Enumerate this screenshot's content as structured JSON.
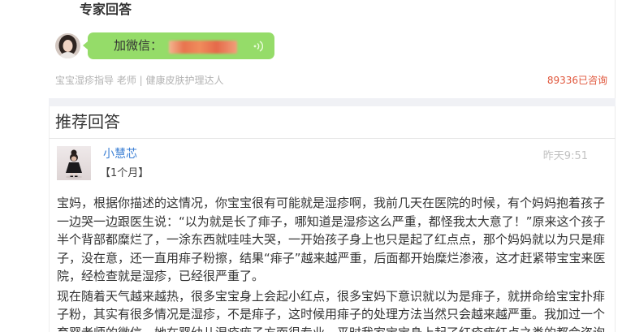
{
  "expert": {
    "heading": "专家回答",
    "bubble_label": "加微信：",
    "bubble_icon": "sound-wave-icon",
    "info": "宝宝湿疹指导 老师 | 健康皮肤护理达人",
    "consult_count": "89336已咨询"
  },
  "recommended": {
    "heading": "推荐回答",
    "answer": {
      "user_name": "小慧芯",
      "baby_age": "【1个月】",
      "time": "昨天9:51",
      "paragraphs": [
        {
          "lines": [
            "宝妈，根据你描述的这情况，你宝宝很有可能就是湿疹啊，我前几天在医院的时候，有个妈妈抱着孩子",
            "一边哭一边跟医生说：“以为就是长了痱子，哪知道是湿疹这么严重，都怪我太大意了！”原来这个孩子",
            "半个背部都糜烂了，一涂东西就哇哇大哭，一开始孩子身上也只是起了红点点，那个妈妈就以为只是痱",
            "子，没在意，还一直用痱子粉擦，结果“痱子”越来越严重，后面都开始糜烂渗液，这才赶紧带宝宝来医",
            "院，经检查就是湿疹，已经很严重了。"
          ]
        },
        {
          "lines": [
            "现在随着天气越来越热，很多宝宝身上会起小红点，很多宝妈下意识就以为是痱子，就拼命给宝宝扑痱",
            "子粉，其实有很多情况是湿疹，不是痱子，这时候用痱子的处理方法当然只会越来越严重。我加过一个",
            "育婴老师的微信，她在婴幼儿湿疹痱子方面很专业，平时我家宝宝身上起了红疹痱红点之类的都会咨询"
          ]
        }
      ]
    }
  },
  "colors": {
    "bubble_green": "#95dc69",
    "link_blue": "#3b7fd4",
    "consult_red": "#e0563b",
    "muted_gray": "#b3b3b3",
    "band_gray": "#f0f1f5"
  }
}
